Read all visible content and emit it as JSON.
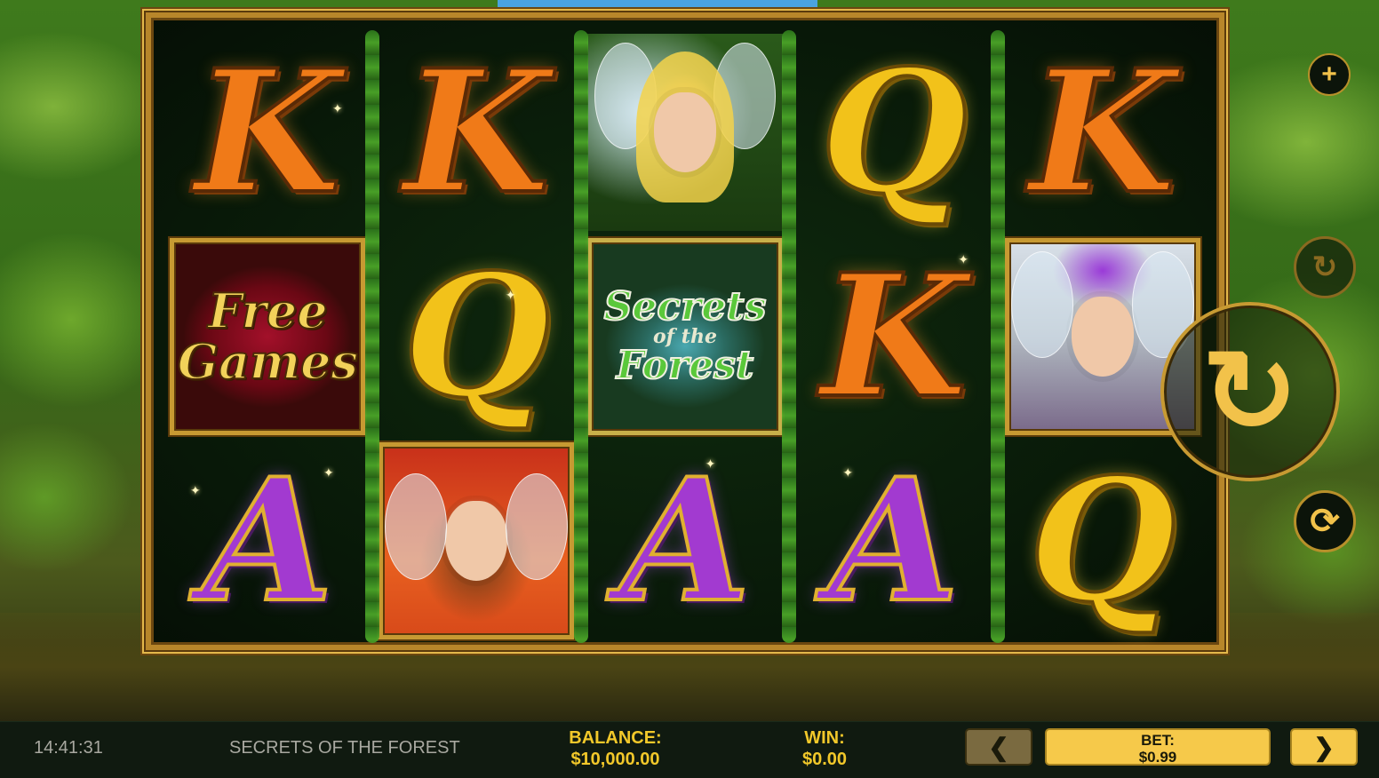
{
  "game": {
    "title": "SECRETS OF THE FOREST",
    "clock": "14:41:31"
  },
  "reels": [
    [
      "K",
      "free-games",
      "A"
    ],
    [
      "K",
      "Q",
      "fairy-red"
    ],
    [
      "fairy-blonde",
      "secrets-of-the-forest-logo",
      "A"
    ],
    [
      "Q",
      "K",
      "A"
    ],
    [
      "K",
      "fairy-purple",
      "Q"
    ]
  ],
  "symbols": {
    "free_games_line1": "Free",
    "free_games_line2": "Games",
    "logo_line1": "Secrets",
    "logo_line2": "of the",
    "logo_line3": "Forest"
  },
  "controls": {
    "plus_icon": "plus-icon",
    "turbo_icon": "turbo-icon",
    "spin_icon": "spin-icon",
    "autoplay_icon": "autoplay-icon"
  },
  "bottom_bar": {
    "balance_label": "BALANCE:",
    "balance_value": "$10,000.00",
    "win_label": "WIN:",
    "win_value": "$0.00",
    "bet_label": "BET:",
    "bet_value": "$0.99",
    "bet_down_glyph": "❮",
    "bet_up_glyph": "❯"
  },
  "colors": {
    "accent_gold": "#f2c82a",
    "bet_button": "#f6c94a",
    "bar_background": "#101a10"
  }
}
